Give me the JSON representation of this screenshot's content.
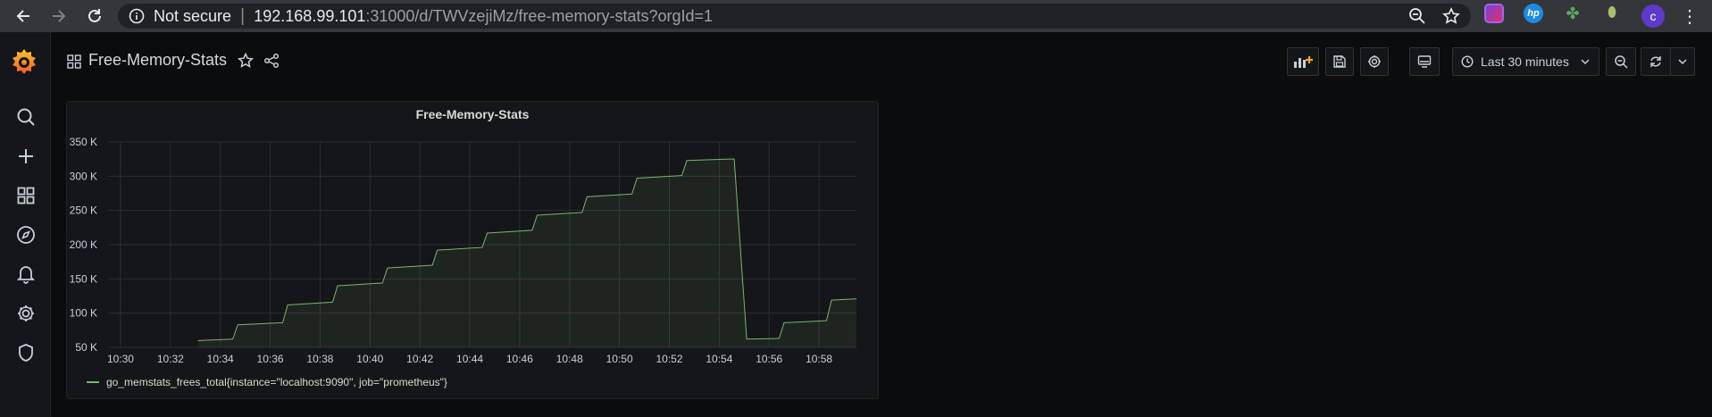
{
  "browser": {
    "secure_label": "Not secure",
    "url_host": "192.168.99.101",
    "url_rest": ":31000/d/TWVzejiMz/free-memory-stats?orgId=1",
    "profile_initial": "c"
  },
  "dashboard": {
    "title": "Free-Memory-Stats",
    "time_range": "Last 30 minutes"
  },
  "panel": {
    "title": "Free-Memory-Stats",
    "legend": "go_memstats_frees_total{instance=\"localhost:9090\", job=\"prometheus\"}"
  },
  "colors": {
    "series": "#7eb26d",
    "background": "#0b0c0e",
    "panel": "#141619"
  },
  "chart_data": {
    "type": "area",
    "title": "Free-Memory-Stats",
    "x_ticks": [
      "10:30",
      "10:32",
      "10:34",
      "10:36",
      "10:38",
      "10:40",
      "10:42",
      "10:44",
      "10:46",
      "10:48",
      "10:50",
      "10:52",
      "10:54",
      "10:56",
      "10:58"
    ],
    "y_ticks": [
      "50 K",
      "100 K",
      "150 K",
      "200 K",
      "250 K",
      "300 K",
      "350 K"
    ],
    "xlim": [
      "10:29.5",
      "10:59.5"
    ],
    "ylim": [
      50000,
      350000
    ],
    "grid": true,
    "legend_position": "bottom-left",
    "series": [
      {
        "name": "go_memstats_frees_total{instance=\"localhost:9090\", job=\"prometheus\"}",
        "x": [
          "10:33.1",
          "10:34.5",
          "10:34.7",
          "10:36.5",
          "10:36.7",
          "10:38.5",
          "10:38.7",
          "10:40.5",
          "10:40.7",
          "10:42.5",
          "10:42.7",
          "10:44.5",
          "10:44.7",
          "10:46.5",
          "10:46.7",
          "10:48.5",
          "10:48.7",
          "10:50.5",
          "10:50.7",
          "10:52.5",
          "10:52.7",
          "10:54.4",
          "10:54.6",
          "10:55.1",
          "10:56.4",
          "10:56.6",
          "10:58.3",
          "10:58.5",
          "10:59.5"
        ],
        "values": [
          60000,
          62000,
          83000,
          86000,
          112000,
          116000,
          140000,
          144000,
          166000,
          170000,
          192000,
          196000,
          217000,
          221000,
          243000,
          247000,
          270000,
          274000,
          297000,
          301000,
          323000,
          325000,
          325000,
          62000,
          63000,
          86000,
          89000,
          119000,
          121000
        ]
      }
    ]
  }
}
